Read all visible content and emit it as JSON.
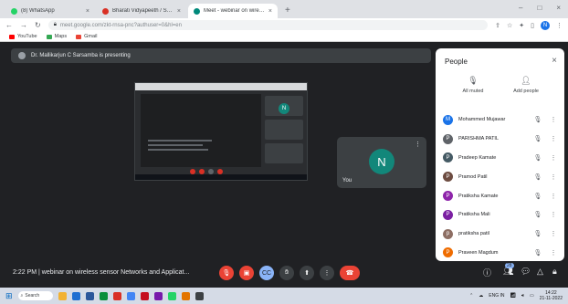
{
  "tabs": [
    {
      "label": "(8) WhatsApp",
      "color": "#25d366",
      "active": false
    },
    {
      "label": "Bharati Vidyapeeth / Sasoore Institute of Technology",
      "color": "#d93025",
      "active": false
    },
    {
      "label": "Meet - webinar on wireless",
      "color": "#00897b",
      "active": true
    }
  ],
  "window_controls": {
    "minimize": "–",
    "restore": "□",
    "close": "×"
  },
  "address": {
    "url": "meet.google.com/zkt-rnsa-pnc?authuser=0&hl=en"
  },
  "profile_initial": "N",
  "bookmarks": [
    {
      "label": "YouTube",
      "color": "#ff0000"
    },
    {
      "label": "Maps",
      "color": "#34a853"
    },
    {
      "label": "Gmail",
      "color": "#ea4335"
    }
  ],
  "presenting_banner": "Dr. Mallikarjun C Sarsamba is presenting",
  "self_tile": {
    "initial": "N",
    "name": "You"
  },
  "people": {
    "title": "People",
    "close": "×",
    "all_muted": "All muted",
    "add_people": "Add people",
    "participants": [
      {
        "name": "Mohammed Mujawar",
        "initial": "M",
        "color": "#1a73e8"
      },
      {
        "name": "PARISHMA PATIL",
        "initial": "P",
        "color": "#5f6368"
      },
      {
        "name": "Pradeep Kamate",
        "initial": "P",
        "color": "#455a64"
      },
      {
        "name": "Pramod Patil",
        "initial": "P",
        "color": "#6d4c41"
      },
      {
        "name": "Pratiksha Kamate",
        "initial": "P",
        "color": "#8e24aa"
      },
      {
        "name": "Pratiksha Mali",
        "initial": "P",
        "color": "#7b1fa2"
      },
      {
        "name": "pratiksha patil",
        "initial": "p",
        "color": "#8d6e63"
      },
      {
        "name": "Praveen Magdum",
        "initial": "P",
        "color": "#ef6c00"
      }
    ]
  },
  "meeting_info": {
    "time": "2:22 PM",
    "title": "webinar on wireless sensor Networks and Applicat..."
  },
  "participant_count": "28",
  "taskbar": {
    "search": "Search",
    "apps": [
      "#f2b233",
      "#1f6fd1",
      "#2b579a",
      "#0a8f3c",
      "#d93025",
      "#4285f4",
      "#c50f1f",
      "#7719aa",
      "#25d366",
      "#e37400",
      "#3c4043"
    ],
    "lang": "ENG",
    "region": "IN",
    "time": "14:22",
    "date": "21-11-2022"
  }
}
